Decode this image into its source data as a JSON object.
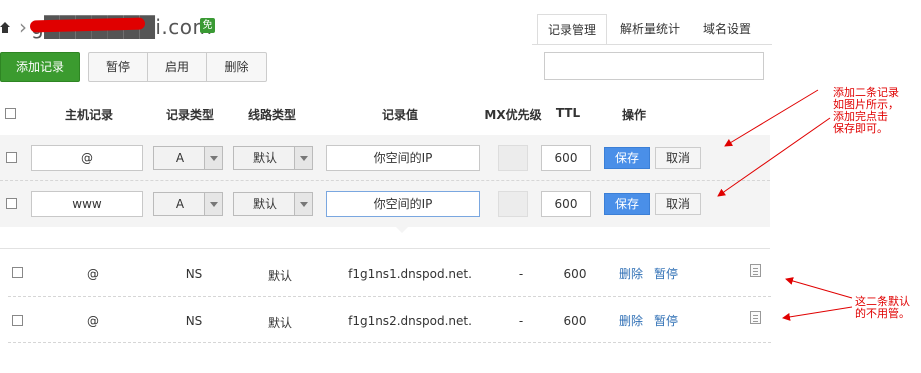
{
  "header": {
    "domain": "g███████i.com",
    "free_badge": "免",
    "tabs": [
      {
        "label": "记录管理",
        "active": true
      },
      {
        "label": "解析量统计",
        "active": false
      },
      {
        "label": "域名设置",
        "active": false
      }
    ]
  },
  "toolbar": {
    "add_label": "添加记录",
    "pause_label": "暂停",
    "enable_label": "启用",
    "delete_label": "删除",
    "search_value": ""
  },
  "table": {
    "columns": [
      "主机记录",
      "记录类型",
      "线路类型",
      "记录值",
      "MX优先级",
      "TTL",
      "操作"
    ],
    "edit_rows": [
      {
        "host": "@",
        "type": "A",
        "line": "默认",
        "value": "你空间的IP",
        "mx": "",
        "ttl": "600",
        "save": "保存",
        "cancel": "取消"
      },
      {
        "host": "www",
        "type": "A",
        "line": "默认",
        "value": "你空间的IP",
        "mx": "",
        "ttl": "600",
        "save": "保存",
        "cancel": "取消"
      }
    ],
    "rows": [
      {
        "host": "@",
        "type": "NS",
        "line": "默认",
        "value": "f1g1ns1.dnspod.net.",
        "mx": "-",
        "ttl": "600",
        "delete": "删除",
        "pause": "暂停"
      },
      {
        "host": "@",
        "type": "NS",
        "line": "默认",
        "value": "f1g1ns2.dnspod.net.",
        "mx": "-",
        "ttl": "600",
        "delete": "删除",
        "pause": "暂停"
      }
    ]
  },
  "annotations": {
    "top": [
      "添加二条记录",
      "如图片所示，",
      "添加完点击",
      "保存即可。"
    ],
    "bottom": [
      "这二条默认",
      "的不用管。"
    ],
    "color": "#e00000"
  },
  "colors": {
    "add_button": "#3b9b2f",
    "save_button": "#4a8fe8",
    "link": "#2f6fb5"
  }
}
